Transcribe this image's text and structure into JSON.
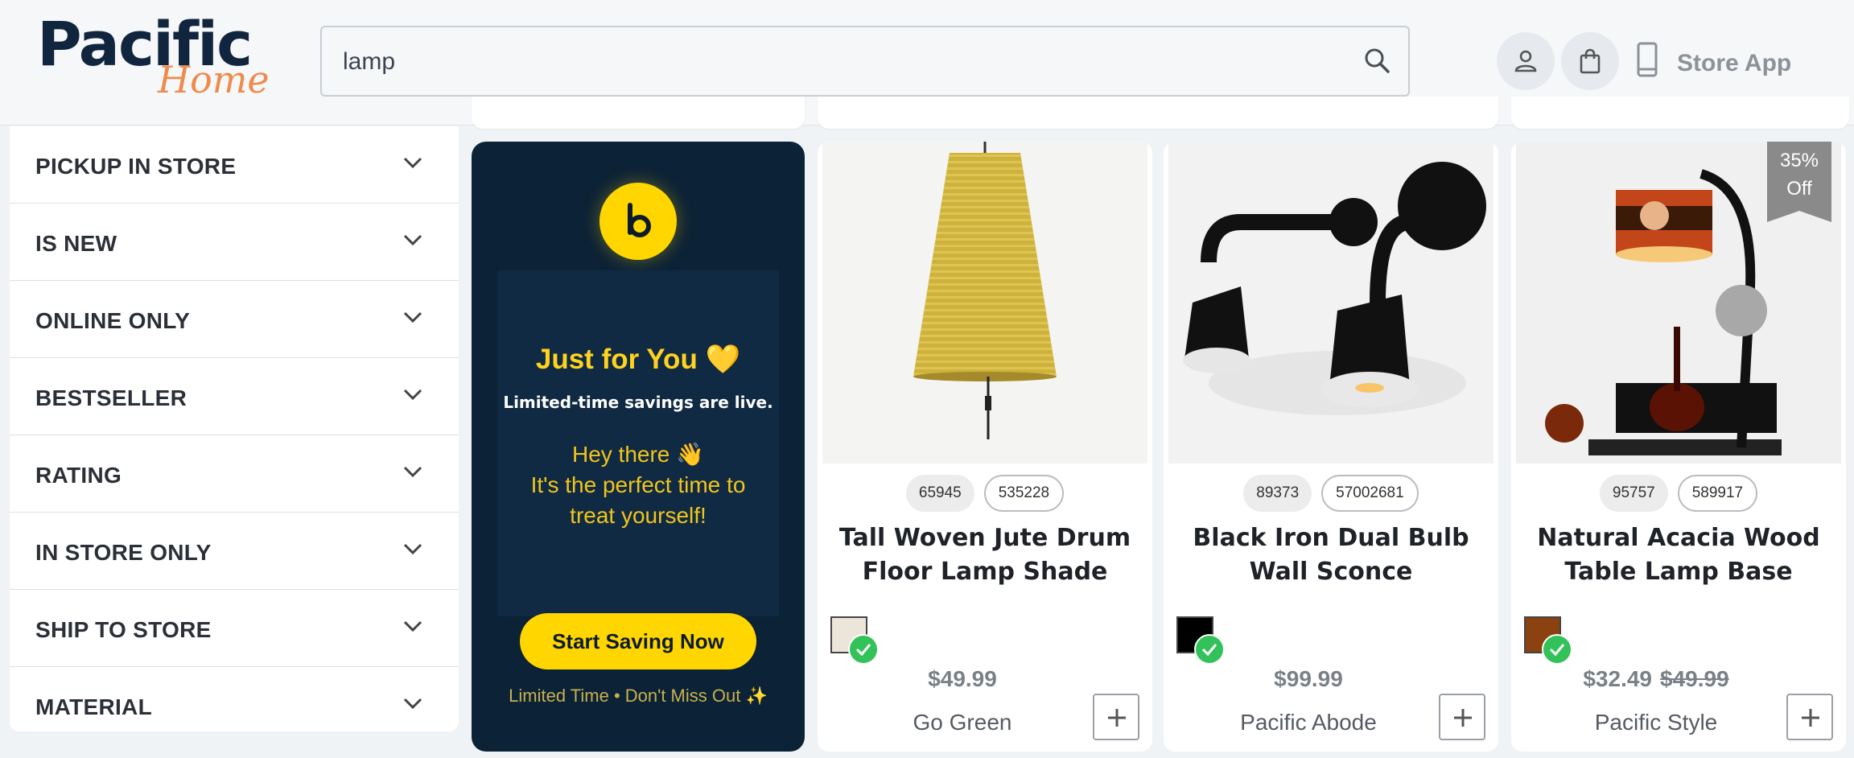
{
  "header": {
    "logo_main": "Pacific",
    "logo_sub": "Home",
    "search_value": "lamp",
    "store_app_label": "Store App"
  },
  "filters": [
    {
      "label": "PICKUP IN STORE"
    },
    {
      "label": "IS NEW"
    },
    {
      "label": "ONLINE ONLY"
    },
    {
      "label": "BESTSELLER"
    },
    {
      "label": "RATING"
    },
    {
      "label": "IN STORE ONLY"
    },
    {
      "label": "SHIP TO STORE"
    },
    {
      "label": "MATERIAL"
    }
  ],
  "promo": {
    "title": "Just for You 💛",
    "subtitle": "Limited-time savings are live.",
    "message_line1": "Hey there 👋",
    "message_line2": "It's the perfect time to treat yourself!",
    "button_label": "Start Saving Now",
    "footer": "Limited Time • Don't Miss Out ✨"
  },
  "products": [
    {
      "chip1": "65945",
      "chip2": "535228",
      "name": "Tall Woven Jute Drum Floor Lamp Shade",
      "swatch_color": "#ece6da",
      "price": "$49.99",
      "brand": "Go Green"
    },
    {
      "chip1": "89373",
      "chip2": "57002681",
      "name": "Black Iron Dual Bulb Wall Sconce",
      "swatch_color": "#000000",
      "price": "$99.99",
      "brand": "Pacific Abode"
    },
    {
      "chip1": "95757",
      "chip2": "589917",
      "name": "Natural Acacia Wood Table Lamp Base",
      "swatch_color": "#8b4210",
      "price": "$32.49",
      "price_old": "$49.99",
      "brand": "Pacific Style",
      "badge_line1": "35%",
      "badge_line2": "Off"
    }
  ],
  "colors": {
    "accent_yellow": "#ffd600",
    "promo_bg": "#0c2236",
    "check_green": "#33c25a",
    "logo_navy": "#11263e",
    "logo_orange": "#f08a4b"
  }
}
